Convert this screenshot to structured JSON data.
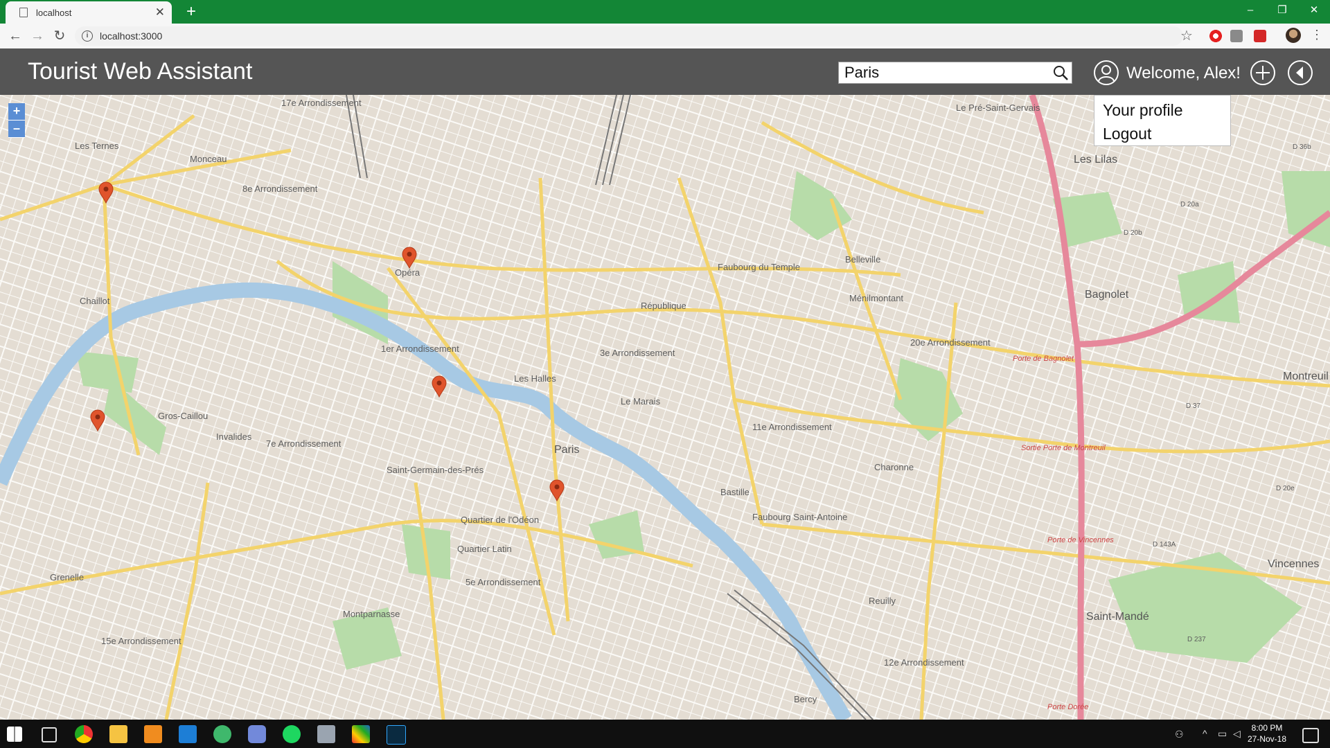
{
  "browser": {
    "tab_title": "localhost",
    "new_tab": "+",
    "url": "localhost:3000",
    "window_controls": [
      "–",
      "❐",
      "✕"
    ]
  },
  "app": {
    "title": "Tourist Web Assistant",
    "search_value": "Paris",
    "welcome": "Welcome, Alex!",
    "menu": [
      "Your profile",
      "Logout"
    ]
  },
  "map": {
    "zoom_in": "+",
    "zoom_out": "–",
    "colors": {
      "background": "#eae6df",
      "river": "#a7c9e4",
      "park": "#b7dca9",
      "major_road": "#f3d36b",
      "motorway": "#e6889b",
      "marker": "#e0542c"
    },
    "labels": {
      "arr17": "17e Arrondissement",
      "arr8": "8e Arrondissement",
      "arr1": "1er Arrondissement",
      "arr3": "3e Arrondissement",
      "arr7": "7e Arrondissement",
      "arr5": "5e Arrondissement",
      "arr15": "15e Arrondissement",
      "arr11": "11e Arrondissement",
      "arr20": "20e Arrondissement",
      "arr12": "12e Arrondissement",
      "paris": "Paris",
      "les_lilas": "Les Lilas",
      "bagnolet": "Bagnolet",
      "montreuil": "Montreuil",
      "vincennes": "Vincennes",
      "saint_mande": "Saint-Mandé",
      "le_pre": "Le Pré-Saint-Gervais",
      "menilmontant": "Ménilmontant",
      "belleville": "Belleville",
      "charonne": "Charonne",
      "le_marais": "Le Marais",
      "les_halles": "Les Halles",
      "opera": "Opéra",
      "chaillot": "Chaillot",
      "gros_caillou": "Gros-Caillou",
      "grenelle": "Grenelle",
      "montparnasse": "Montparnasse",
      "saint_germain": "Saint-Germain-des-Prés",
      "quartier_latin": "Quartier Latin",
      "faubourg_saint_antoine": "Faubourg Saint-Antoine",
      "reuilly": "Reuilly",
      "bercy": "Bercy",
      "les_ternes": "Les Ternes",
      "monceau": "Monceau",
      "faubourg_du_temple": "Faubourg du Temple",
      "republique": "République",
      "bastille": "Bastille",
      "quartier_odeon": "Quartier de l'Odéon",
      "invalides": "Invalides",
      "porte_de_bagnolet": "Porte de Bagnolet",
      "porte_de_montreuil": "Sortie Porte de Montreuil",
      "porte_de_vincennes": "Porte de Vincennes",
      "porte_doree": "Porte Dorée",
      "d36b": "D 36b",
      "d20a": "D 20a",
      "d20b": "D 20b",
      "d37": "D 37",
      "d20e": "D 20e",
      "d143a": "D 143A",
      "d237": "D 237"
    }
  },
  "taskbar": {
    "time": "8:00 PM",
    "date": "27-Nov-18"
  }
}
